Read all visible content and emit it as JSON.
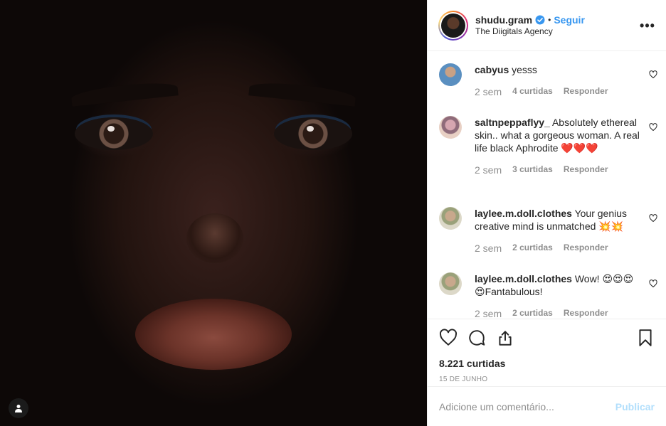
{
  "post": {
    "username": "shudu.gram",
    "follow_label": "Seguir",
    "separator": "•",
    "location": "The Diigitals Agency",
    "more_label": "•••"
  },
  "comments": [
    {
      "user": "cabyus",
      "text": "yesss",
      "time": "2 sem",
      "likes": "4 curtidas",
      "reply": "Responder"
    },
    {
      "user": "saltnpeppaflyy_",
      "text": "Absolutely ethereal skin.. what a gorgeous woman. A real life black Aphrodite ❤️❤️❤️",
      "time": "2 sem",
      "likes": "3 curtidas",
      "reply": "Responder"
    },
    {
      "user": "laylee.m.doll.clothes",
      "text": "Your genius creative mind is unmatched 💥💥",
      "time": "2 sem",
      "likes": "2 curtidas",
      "reply": "Responder"
    },
    {
      "user": "laylee.m.doll.clothes",
      "text": "Wow! 😍😍😍😍Fantabulous!",
      "time": "2 sem",
      "likes": "2 curtidas",
      "reply": "Responder"
    }
  ],
  "actions": {
    "likes_count": "8.221 curtidas",
    "date": "15 DE JUNHO"
  },
  "add_comment": {
    "placeholder": "Adicione um comentário...",
    "publish_label": "Publicar"
  },
  "colors": {
    "accent": "#3897f0",
    "publish_disabled": "#b2dffc",
    "secondary_text": "#8e8e8e"
  },
  "icons": [
    "user-tag-icon",
    "verified-badge-icon",
    "heart-icon",
    "comment-icon",
    "share-icon",
    "bookmark-icon",
    "like-heart-small-icon",
    "more-options-icon"
  ]
}
